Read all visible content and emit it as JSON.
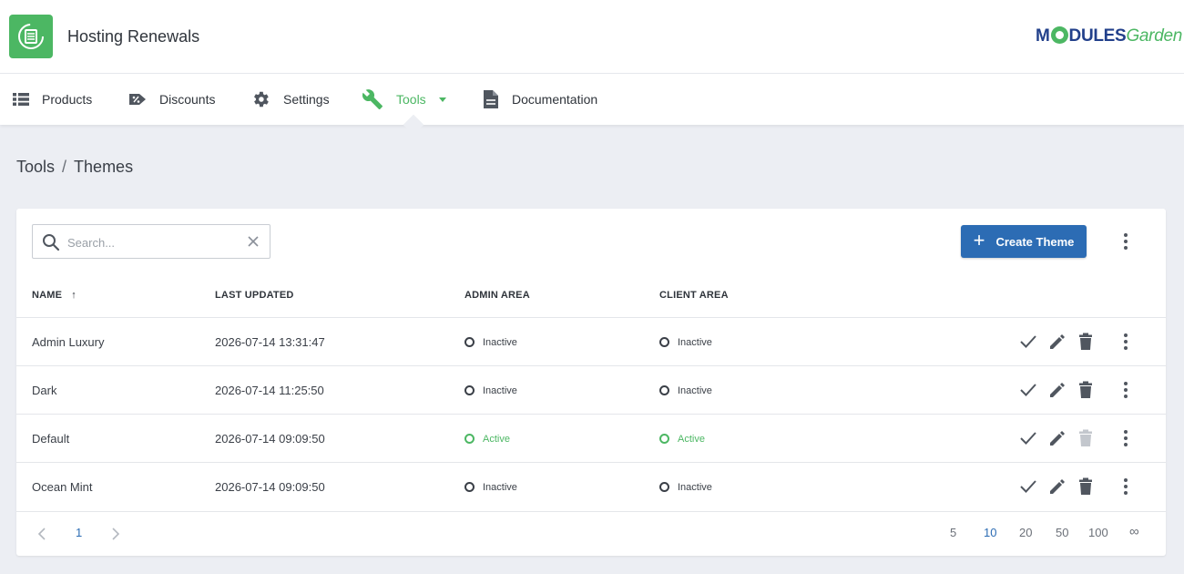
{
  "header": {
    "app_title": "Hosting Renewals",
    "brand_part1": "M",
    "brand_part2": "DULES",
    "brand_part3": "Garden",
    "app_icon": "server-renew-icon",
    "accent_color": "#4cb763",
    "primary_color": "#2c6cb4"
  },
  "nav": {
    "items": [
      {
        "label": "Products",
        "icon": "list-icon"
      },
      {
        "label": "Discounts",
        "icon": "tag-percent-icon"
      },
      {
        "label": "Settings",
        "icon": "gear-icon"
      },
      {
        "label": "Tools",
        "icon": "wrench-icon",
        "active": true
      },
      {
        "label": "Documentation",
        "icon": "document-icon"
      }
    ]
  },
  "breadcrumb": {
    "parent": "Tools",
    "separator": "/",
    "current": "Themes"
  },
  "toolbar": {
    "search_placeholder": "Search...",
    "create_label": "Create Theme"
  },
  "table": {
    "columns": [
      "NAME",
      "LAST UPDATED",
      "ADMIN AREA",
      "CLIENT AREA"
    ],
    "sort_indicator": "↑",
    "rows": [
      {
        "name": "Admin Luxury",
        "updated": "2026-07-14 13:31:47",
        "admin": "Inactive",
        "client": "Inactive",
        "delete_enabled": true
      },
      {
        "name": "Dark",
        "updated": "2026-07-14 11:25:50",
        "admin": "Inactive",
        "client": "Inactive",
        "delete_enabled": true
      },
      {
        "name": "Default",
        "updated": "2026-07-14 09:09:50",
        "admin": "Active",
        "client": "Active",
        "delete_enabled": false
      },
      {
        "name": "Ocean Mint",
        "updated": "2026-07-14 09:09:50",
        "admin": "Inactive",
        "client": "Inactive",
        "delete_enabled": true
      }
    ]
  },
  "pagination": {
    "current_page": "1",
    "page_sizes": [
      "5",
      "10",
      "20",
      "50",
      "100",
      "∞"
    ],
    "selected_size": "10"
  }
}
